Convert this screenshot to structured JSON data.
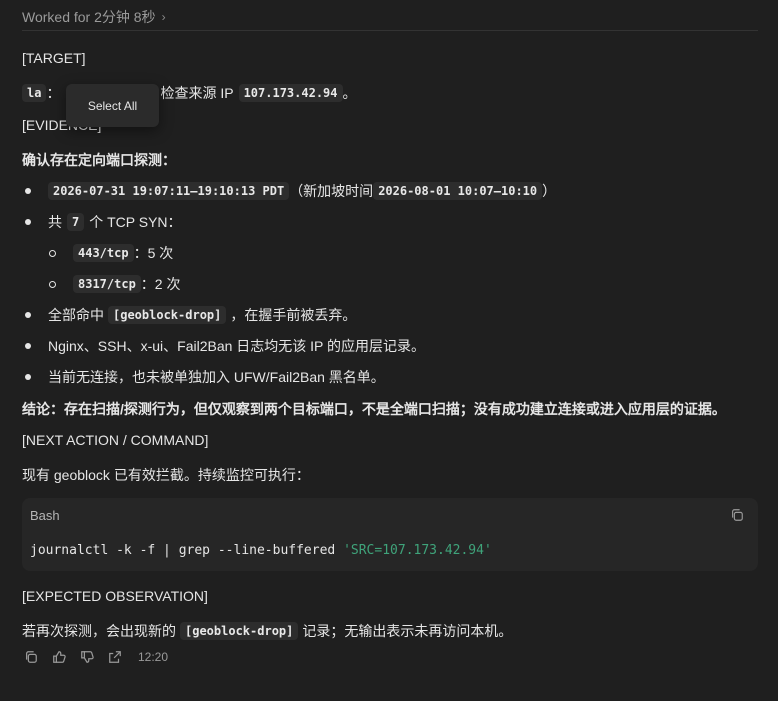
{
  "header": {
    "worked": "Worked for 2分钟 8秒"
  },
  "target": {
    "heading": "[TARGET]",
    "prefix_code": "la",
    "colon": "：",
    "text": "，检查来源 IP",
    "ip": "107.173.42.94",
    "end": "。"
  },
  "context_menu": {
    "select_all": "Select All"
  },
  "evidence": {
    "heading": "[EVIDENCE]",
    "confirm": "确认存在定向端口探测：",
    "b1_code1": "2026-07-31 19:07:11–19:10:13 PDT",
    "b1_text": "（新加坡时间",
    "b1_code2": "2026-08-01 10:07–10:10",
    "b1_end": "）",
    "b2_pre": "共",
    "b2_code": "7",
    "b2_post": "个 TCP SYN：",
    "sub1_code": "443/tcp",
    "sub1_text": "：5 次",
    "sub2_code": "8317/tcp",
    "sub2_text": "：2 次",
    "b3_pre": "全部命中",
    "b3_code": "[geoblock-drop]",
    "b3_post": "，在握手前被丢弃。",
    "b4": "Nginx、SSH、x-ui、Fail2Ban 日志均无该 IP 的应用层记录。",
    "b5": "当前无连接，也未被单独加入 UFW/Fail2Ban 黑名单。",
    "conclusion_label": "结论：",
    "conclusion": "存在扫描/探测行为，但仅观察到两个目标端口，不是全端口扫描；没有成功建立连接或进入应用层的证据。"
  },
  "next": {
    "heading": "[NEXT ACTION / COMMAND]",
    "text": "现有 geoblock 已有效拦截。持续监控可执行："
  },
  "code": {
    "lang": "Bash",
    "cmd": "journalctl -k -f | grep --line-buffered ",
    "arg": "'SRC=107.173.42.94'"
  },
  "expected": {
    "heading": "[EXPECTED OBSERVATION]",
    "pre": "若再次探测，会出现新的",
    "code": "[geoblock-drop]",
    "post": "记录；无输出表示未再访问本机。"
  },
  "footer": {
    "time": "12:20"
  },
  "icons": [
    "chevron-right-icon",
    "copy-icon",
    "thumbs-up-icon",
    "thumbs-down-icon",
    "share-icon"
  ]
}
